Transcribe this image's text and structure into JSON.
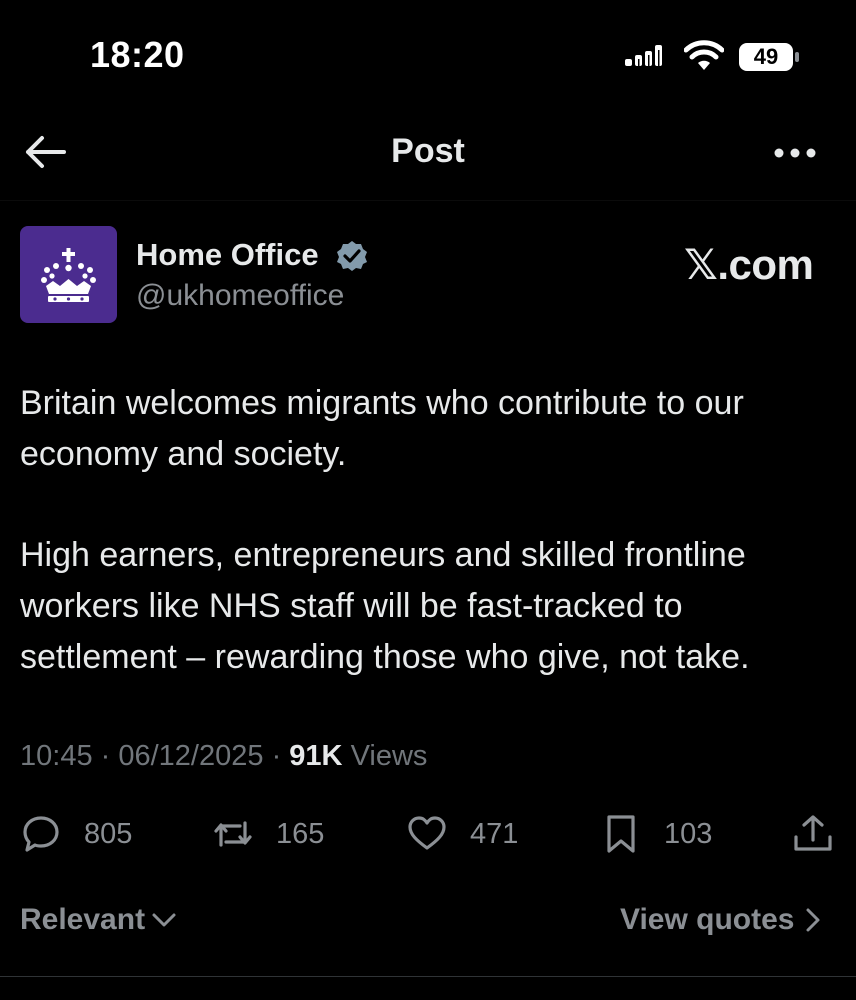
{
  "status_bar": {
    "time": "18:20",
    "battery": "49"
  },
  "header": {
    "title": "Post"
  },
  "author": {
    "name": "Home Office",
    "handle": "@ukhomeoffice",
    "avatar_color": "#4b2c8f",
    "verified_color": "#829aab"
  },
  "watermark": "𝕏.com",
  "post": {
    "paragraphs": [
      "Britain welcomes migrants who contribute to our economy and society.",
      "High earners, entrepreneurs and skilled frontline workers like NHS staff will be fast-tracked to settlement – rewarding those who give, not take."
    ],
    "time": "10:45",
    "date": "06/12/2025",
    "views_count": "91K",
    "views_label": "Views"
  },
  "actions": {
    "replies": "805",
    "reposts": "165",
    "likes": "471",
    "bookmarks": "103"
  },
  "footer": {
    "sort_label": "Relevant",
    "quotes_label": "View quotes"
  }
}
